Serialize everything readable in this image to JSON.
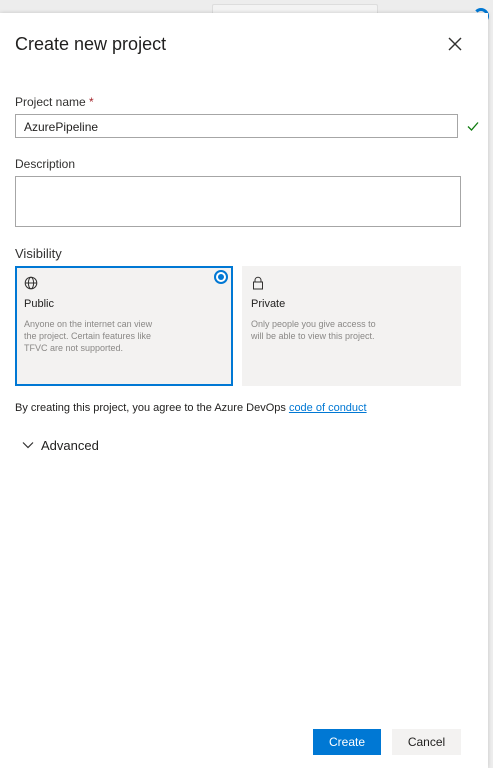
{
  "dialog": {
    "title": "Create new project"
  },
  "project_name": {
    "label": "Project name",
    "required_marker": "*",
    "value": "AzurePipeline"
  },
  "description": {
    "label": "Description",
    "value": ""
  },
  "visibility": {
    "label": "Visibility",
    "selected": "Public",
    "options": [
      {
        "title": "Public",
        "icon": "globe-icon",
        "description": "Anyone on the internet can view the project. Certain features like TFVC are not supported."
      },
      {
        "title": "Private",
        "icon": "lock-icon",
        "description": "Only people you give access to will be able to view this project."
      }
    ]
  },
  "agreement": {
    "text": "By creating this project, you agree to the Azure DevOps",
    "link_text": "code of conduct"
  },
  "advanced": {
    "label": "Advanced"
  },
  "actions": {
    "create_label": "Create",
    "cancel_label": "Cancel"
  },
  "colors": {
    "accent": "#0078d4",
    "required": "#a4262c",
    "card_background": "#f3f2f1"
  }
}
